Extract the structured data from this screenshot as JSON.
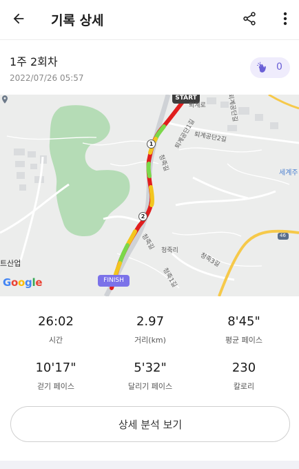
{
  "header": {
    "title": "기록 상세",
    "back_icon": "arrow-left-icon",
    "share_icon": "share-icon",
    "more_icon": "more-vertical-icon"
  },
  "record": {
    "name": "1주 2회차",
    "datetime": "2022/07/26 05:57",
    "likes": "0",
    "like_icon": "clap-hands-icon"
  },
  "map": {
    "start_label": "START",
    "finish_label": "FINISH",
    "km_markers": [
      "1",
      "2"
    ],
    "place_labels": {
      "cheongjuk_gil_1": "청죽길",
      "cheongjuk_gil_2": "청죽길",
      "cheongjuk_ri": "청죽리",
      "cheongjuk_3gil": "청죽3길",
      "cheongjuk_1gil": "청죽1길",
      "industrial_1gil": "퇴계공단1길",
      "industrial_2gil": "퇴계공단2길",
      "industrial_road": "퇴계공단길",
      "toegye_ro": "퇴계로",
      "world": "세계주",
      "poi": "트산업",
      "route_46": "46"
    },
    "attribution": "Google"
  },
  "stats": [
    {
      "value": "26:02",
      "label": "시간"
    },
    {
      "value": "2.97",
      "label": "거리(km)"
    },
    {
      "value": "8'45\"",
      "label": "평균 페이스"
    },
    {
      "value": "10'17\"",
      "label": "걷기 페이스"
    },
    {
      "value": "5'32\"",
      "label": "달리기 페이스"
    },
    {
      "value": "230",
      "label": "칼로리"
    }
  ],
  "actions": {
    "detail_analysis_label": "상세 분석 보기"
  },
  "colors": {
    "accent": "#7b72e9",
    "pill_bg": "#efecfc",
    "route_fast": "#e01e1e",
    "route_mid": "#f2c61f",
    "route_slow": "#7bd84a",
    "park": "#b5dcb6",
    "highway": "#f6c94a"
  }
}
